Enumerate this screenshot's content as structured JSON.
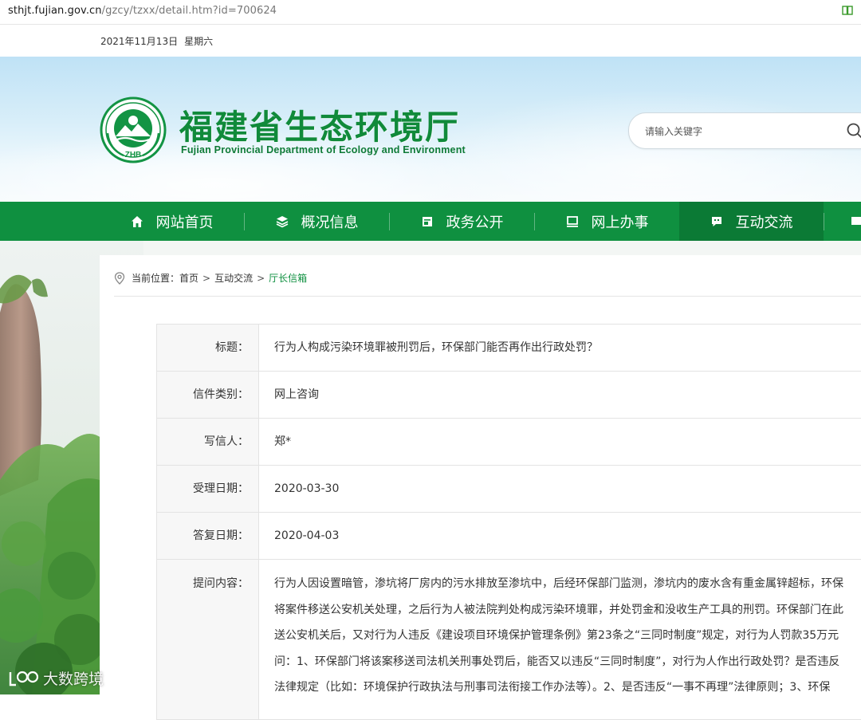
{
  "browser": {
    "url_host": "sthjt.fujian.gov.cn",
    "url_path": "/gzcy/tzxx/detail.htm?id=700624"
  },
  "topbar": {
    "date": "2021年11月13日",
    "weekday": "星期六"
  },
  "header": {
    "logo_emblem_text": "ZHB",
    "site_title_cn": "福建省生态环境厅",
    "site_title_en": "Fujian Provincial Department of Ecology and Environment",
    "search_placeholder": "请输入关键字"
  },
  "nav": {
    "items": [
      {
        "label": "网站首页",
        "icon": "home-icon"
      },
      {
        "label": "概况信息",
        "icon": "layers-icon"
      },
      {
        "label": "政务公开",
        "icon": "document-icon"
      },
      {
        "label": "网上办事",
        "icon": "monitor-icon"
      },
      {
        "label": "互动交流",
        "icon": "chat-icon",
        "active": true
      }
    ]
  },
  "breadcrumb": {
    "prefix": "当前位置：",
    "items": [
      "首页",
      "互动交流",
      "厅长信箱"
    ],
    "separator": ">"
  },
  "detail": {
    "rows": [
      {
        "label": "标题：",
        "value": "行为人构成污染环境罪被刑罚后，环保部门能否再作出行政处罚？"
      },
      {
        "label": "信件类别：",
        "value": "网上咨询"
      },
      {
        "label": "写信人：",
        "value": "郑*"
      },
      {
        "label": "受理日期：",
        "value": "2020-03-30"
      },
      {
        "label": "答复日期：",
        "value": "2020-04-03"
      }
    ],
    "content_label": "提问内容：",
    "content_lines": [
      "行为人因设置暗管，渗坑将厂房内的污水排放至渗坑中，后经环保部门监测，渗坑内的废水含有重金属锌超标，环保",
      "将案件移送公安机关处理，之后行为人被法院判处构成污染环境罪，并处罚金和没收生产工具的刑罚。环保部门在此",
      "送公安机关后，又对行为人违反《建设项目环境保护管理条例》第23条之“三同时制度”规定，对行为人罚款35万元",
      "问：1、环保部门将该案移送司法机关刑事处罚后，能否又以违反“三同时制度”，对行为人作出行政处罚？是否违反",
      "法律规定（比如：环境保护行政执法与刑事司法衔接工作办法等）。2、是否违反“一事不再理”法律原则；3、环保"
    ]
  },
  "watermark": {
    "text": "大数跨境"
  },
  "colors": {
    "brand_green": "#0f9040",
    "nav_active": "#0b7a35",
    "crumb_current": "#0f9040"
  }
}
